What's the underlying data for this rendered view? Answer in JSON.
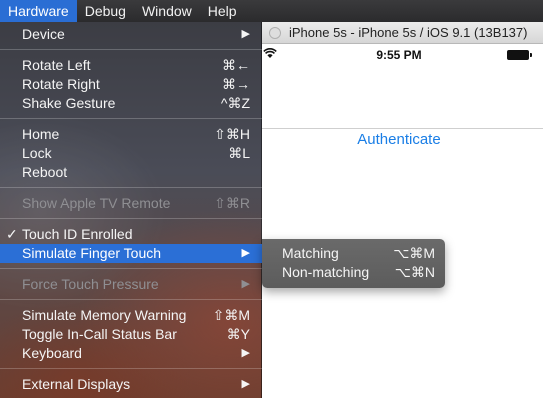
{
  "menubar": {
    "items": [
      "Hardware",
      "Debug",
      "Window",
      "Help"
    ]
  },
  "simulator": {
    "window_title": "iPhone 5s - iPhone 5s / iOS 9.1 (13B137)",
    "status_time": "9:55 PM",
    "authenticate_label": "Authenticate"
  },
  "menu": {
    "items": [
      {
        "label": "Device",
        "shortcut": "",
        "submenu": true
      },
      {
        "label": "Rotate Left",
        "shortcut": "⌘←"
      },
      {
        "label": "Rotate Right",
        "shortcut": "⌘→"
      },
      {
        "label": "Shake Gesture",
        "shortcut": "^⌘Z"
      },
      {
        "label": "Home",
        "shortcut": "⇧⌘H"
      },
      {
        "label": "Lock",
        "shortcut": "⌘L"
      },
      {
        "label": "Reboot",
        "shortcut": ""
      },
      {
        "label": "Show Apple TV Remote",
        "shortcut": "⇧⌘R",
        "disabled": true
      },
      {
        "label": "Touch ID Enrolled",
        "checked": true
      },
      {
        "label": "Simulate Finger Touch",
        "submenu": true,
        "highlighted": true
      },
      {
        "label": "Force Touch Pressure",
        "submenu": true,
        "disabled": true
      },
      {
        "label": "Simulate Memory Warning",
        "shortcut": "⇧⌘M"
      },
      {
        "label": "Toggle In-Call Status Bar",
        "shortcut": "⌘Y"
      },
      {
        "label": "Keyboard",
        "submenu": true
      },
      {
        "label": "External Displays",
        "submenu": true
      }
    ],
    "check_glyph": "✓",
    "submenu_arrow": "▶"
  },
  "submenu": {
    "items": [
      {
        "label": "Matching",
        "shortcut": "⌥⌘M"
      },
      {
        "label": "Non-matching",
        "shortcut": "⌥⌘N"
      }
    ]
  },
  "colors": {
    "highlight": "#2b6fd6",
    "link_blue": "#1a7ee6"
  }
}
